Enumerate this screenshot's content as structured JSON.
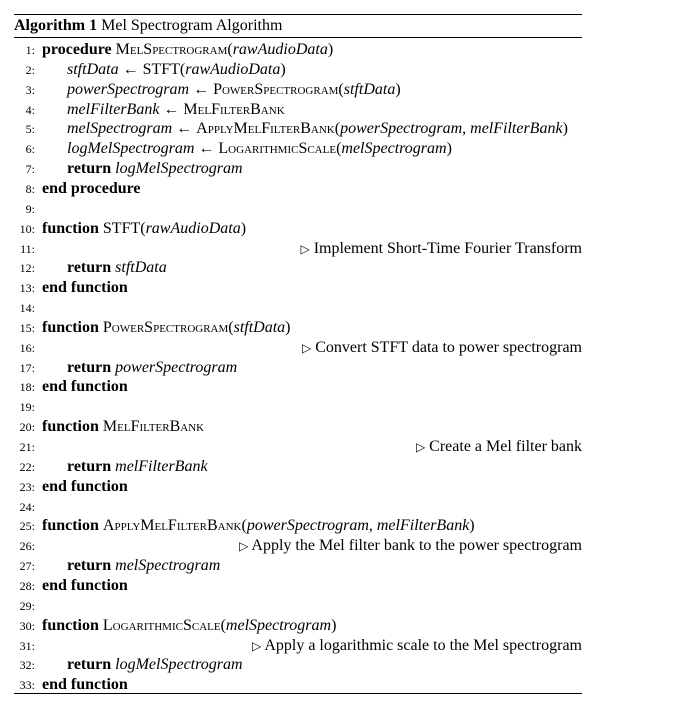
{
  "caption": {
    "label": "Algorithm 1",
    "title": "Mel Spectrogram Algorithm"
  },
  "symbols": {
    "arrow": "←",
    "triangle": "▷"
  },
  "lines": [
    {
      "no": "1:",
      "indent": 0,
      "parts": [
        {
          "s": "kw",
          "t": "procedure"
        },
        {
          "s": "t",
          "t": " "
        },
        {
          "s": "sc",
          "t": "MelSpectrogram"
        },
        {
          "s": "t",
          "t": "("
        },
        {
          "s": "it",
          "t": "rawAudioData"
        },
        {
          "s": "t",
          "t": ")"
        }
      ]
    },
    {
      "no": "2:",
      "indent": 1,
      "parts": [
        {
          "s": "it",
          "t": "stftData"
        },
        {
          "s": "t",
          "t": " ← STFT("
        },
        {
          "s": "it",
          "t": "rawAudioData"
        },
        {
          "s": "t",
          "t": ")"
        }
      ]
    },
    {
      "no": "3:",
      "indent": 1,
      "parts": [
        {
          "s": "it",
          "t": "powerSpectrogram"
        },
        {
          "s": "t",
          "t": " ← "
        },
        {
          "s": "sc",
          "t": "PowerSpectrogram"
        },
        {
          "s": "t",
          "t": "("
        },
        {
          "s": "it",
          "t": "stftData"
        },
        {
          "s": "t",
          "t": ")"
        }
      ]
    },
    {
      "no": "4:",
      "indent": 1,
      "parts": [
        {
          "s": "it",
          "t": "melFilterBank"
        },
        {
          "s": "t",
          "t": " ← "
        },
        {
          "s": "sc",
          "t": "MelFilterBank"
        }
      ]
    },
    {
      "no": "5:",
      "indent": 1,
      "parts": [
        {
          "s": "it",
          "t": "melSpectrogram"
        },
        {
          "s": "t",
          "t": " ← "
        },
        {
          "s": "sc",
          "t": "ApplyMelFilterBank"
        },
        {
          "s": "t",
          "t": "("
        },
        {
          "s": "it",
          "t": "powerSpectrogram"
        },
        {
          "s": "t",
          "t": ", "
        },
        {
          "s": "it",
          "t": "melFilterBank"
        },
        {
          "s": "t",
          "t": ")"
        }
      ]
    },
    {
      "no": "6:",
      "indent": 1,
      "parts": [
        {
          "s": "it",
          "t": "logMelSpectrogram"
        },
        {
          "s": "t",
          "t": " ← "
        },
        {
          "s": "sc",
          "t": "LogarithmicScale"
        },
        {
          "s": "t",
          "t": "("
        },
        {
          "s": "it",
          "t": "melSpectrogram"
        },
        {
          "s": "t",
          "t": ")"
        }
      ]
    },
    {
      "no": "7:",
      "indent": 1,
      "parts": [
        {
          "s": "kw",
          "t": "return"
        },
        {
          "s": "t",
          "t": " "
        },
        {
          "s": "it",
          "t": "logMelSpectrogram"
        }
      ]
    },
    {
      "no": "8:",
      "indent": 0,
      "parts": [
        {
          "s": "kw",
          "t": "end procedure"
        }
      ]
    },
    {
      "no": "9:",
      "indent": 0,
      "parts": []
    },
    {
      "no": "10:",
      "indent": 0,
      "parts": [
        {
          "s": "kw",
          "t": "function"
        },
        {
          "s": "t",
          "t": " STFT("
        },
        {
          "s": "it",
          "t": "rawAudioData"
        },
        {
          "s": "t",
          "t": ")"
        }
      ]
    },
    {
      "no": "11:",
      "indent": 0,
      "parts": [],
      "comment": "Implement Short-Time Fourier Transform"
    },
    {
      "no": "12:",
      "indent": 1,
      "parts": [
        {
          "s": "kw",
          "t": "return"
        },
        {
          "s": "t",
          "t": " "
        },
        {
          "s": "it",
          "t": "stftData"
        }
      ]
    },
    {
      "no": "13:",
      "indent": 0,
      "parts": [
        {
          "s": "kw",
          "t": "end function"
        }
      ]
    },
    {
      "no": "14:",
      "indent": 0,
      "parts": []
    },
    {
      "no": "15:",
      "indent": 0,
      "parts": [
        {
          "s": "kw",
          "t": "function"
        },
        {
          "s": "t",
          "t": " "
        },
        {
          "s": "sc",
          "t": "PowerSpectrogram"
        },
        {
          "s": "t",
          "t": "("
        },
        {
          "s": "it",
          "t": "stftData"
        },
        {
          "s": "t",
          "t": ")"
        }
      ]
    },
    {
      "no": "16:",
      "indent": 0,
      "parts": [],
      "comment": "Convert STFT data to power spectrogram"
    },
    {
      "no": "17:",
      "indent": 1,
      "parts": [
        {
          "s": "kw",
          "t": "return"
        },
        {
          "s": "t",
          "t": " "
        },
        {
          "s": "it",
          "t": "powerSpectrogram"
        }
      ]
    },
    {
      "no": "18:",
      "indent": 0,
      "parts": [
        {
          "s": "kw",
          "t": "end function"
        }
      ]
    },
    {
      "no": "19:",
      "indent": 0,
      "parts": []
    },
    {
      "no": "20:",
      "indent": 0,
      "parts": [
        {
          "s": "kw",
          "t": "function"
        },
        {
          "s": "t",
          "t": " "
        },
        {
          "s": "sc",
          "t": "MelFilterBank"
        }
      ]
    },
    {
      "no": "21:",
      "indent": 0,
      "parts": [],
      "comment": "Create a Mel filter bank"
    },
    {
      "no": "22:",
      "indent": 1,
      "parts": [
        {
          "s": "kw",
          "t": "return"
        },
        {
          "s": "t",
          "t": " "
        },
        {
          "s": "it",
          "t": "melFilterBank"
        }
      ]
    },
    {
      "no": "23:",
      "indent": 0,
      "parts": [
        {
          "s": "kw",
          "t": "end function"
        }
      ]
    },
    {
      "no": "24:",
      "indent": 0,
      "parts": []
    },
    {
      "no": "25:",
      "indent": 0,
      "parts": [
        {
          "s": "kw",
          "t": "function"
        },
        {
          "s": "t",
          "t": " "
        },
        {
          "s": "sc",
          "t": "ApplyMelFilterBank"
        },
        {
          "s": "t",
          "t": "("
        },
        {
          "s": "it",
          "t": "powerSpectrogram"
        },
        {
          "s": "t",
          "t": ", "
        },
        {
          "s": "it",
          "t": "melFilterBank"
        },
        {
          "s": "t",
          "t": ")"
        }
      ]
    },
    {
      "no": "26:",
      "indent": 0,
      "parts": [],
      "comment": "Apply the Mel filter bank to the power spectrogram"
    },
    {
      "no": "27:",
      "indent": 1,
      "parts": [
        {
          "s": "kw",
          "t": "return"
        },
        {
          "s": "t",
          "t": " "
        },
        {
          "s": "it",
          "t": "melSpectrogram"
        }
      ]
    },
    {
      "no": "28:",
      "indent": 0,
      "parts": [
        {
          "s": "kw",
          "t": "end function"
        }
      ]
    },
    {
      "no": "29:",
      "indent": 0,
      "parts": []
    },
    {
      "no": "30:",
      "indent": 0,
      "parts": [
        {
          "s": "kw",
          "t": "function"
        },
        {
          "s": "t",
          "t": " "
        },
        {
          "s": "sc",
          "t": "LogarithmicScale"
        },
        {
          "s": "t",
          "t": "("
        },
        {
          "s": "it",
          "t": "melSpectrogram"
        },
        {
          "s": "t",
          "t": ")"
        }
      ]
    },
    {
      "no": "31:",
      "indent": 0,
      "parts": [],
      "comment": "Apply a logarithmic scale to the Mel spectrogram"
    },
    {
      "no": "32:",
      "indent": 1,
      "parts": [
        {
          "s": "kw",
          "t": "return"
        },
        {
          "s": "t",
          "t": " "
        },
        {
          "s": "it",
          "t": "logMelSpectrogram"
        }
      ]
    },
    {
      "no": "33:",
      "indent": 0,
      "parts": [
        {
          "s": "kw",
          "t": "end function"
        }
      ]
    }
  ]
}
